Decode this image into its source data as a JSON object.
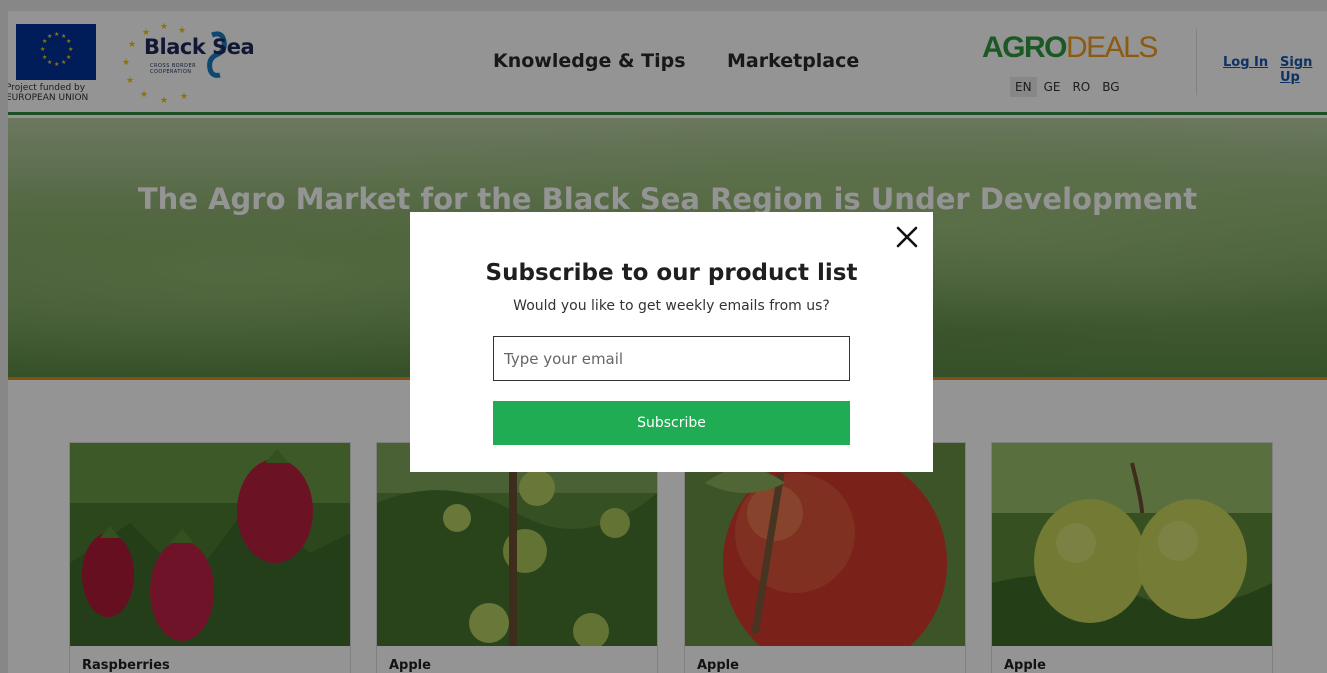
{
  "header": {
    "eu_text_line1": "Project funded by",
    "eu_text_line2": "EUROPEAN UNION",
    "blacksea_title": "Black Sea",
    "blacksea_sub1": "CROSS BORDER",
    "blacksea_sub2": "COOPERATION",
    "nav": [
      "Knowledge & Tips",
      "Marketplace"
    ],
    "brand_part1": "AGRO",
    "brand_part2": "DEALS",
    "languages": [
      "EN",
      "GE",
      "RO",
      "BG"
    ],
    "active_language": "EN",
    "login": "Log In",
    "signup": "Sign Up"
  },
  "hero": {
    "title": "The Agro Market for the Black Sea Region is Under Development"
  },
  "products": [
    {
      "name": "Raspberries",
      "image": "raspberries"
    },
    {
      "name": "Apple",
      "image": "apple-tree-green"
    },
    {
      "name": "Apple",
      "image": "apple-red"
    },
    {
      "name": "Apple",
      "image": "apple-yellow"
    }
  ],
  "modal": {
    "title": "Subscribe to our product list",
    "subtitle": "Would you like to get weekly emails from us?",
    "email_placeholder": "Type your email",
    "button": "Subscribe",
    "close_icon": "close-icon"
  },
  "colors": {
    "accent_green": "#1fac52",
    "brand_green": "#2e9a3e",
    "brand_orange": "#f29b1d",
    "link_blue": "#1a56b0",
    "overlay": "rgba(0,0,0,0.42)"
  }
}
